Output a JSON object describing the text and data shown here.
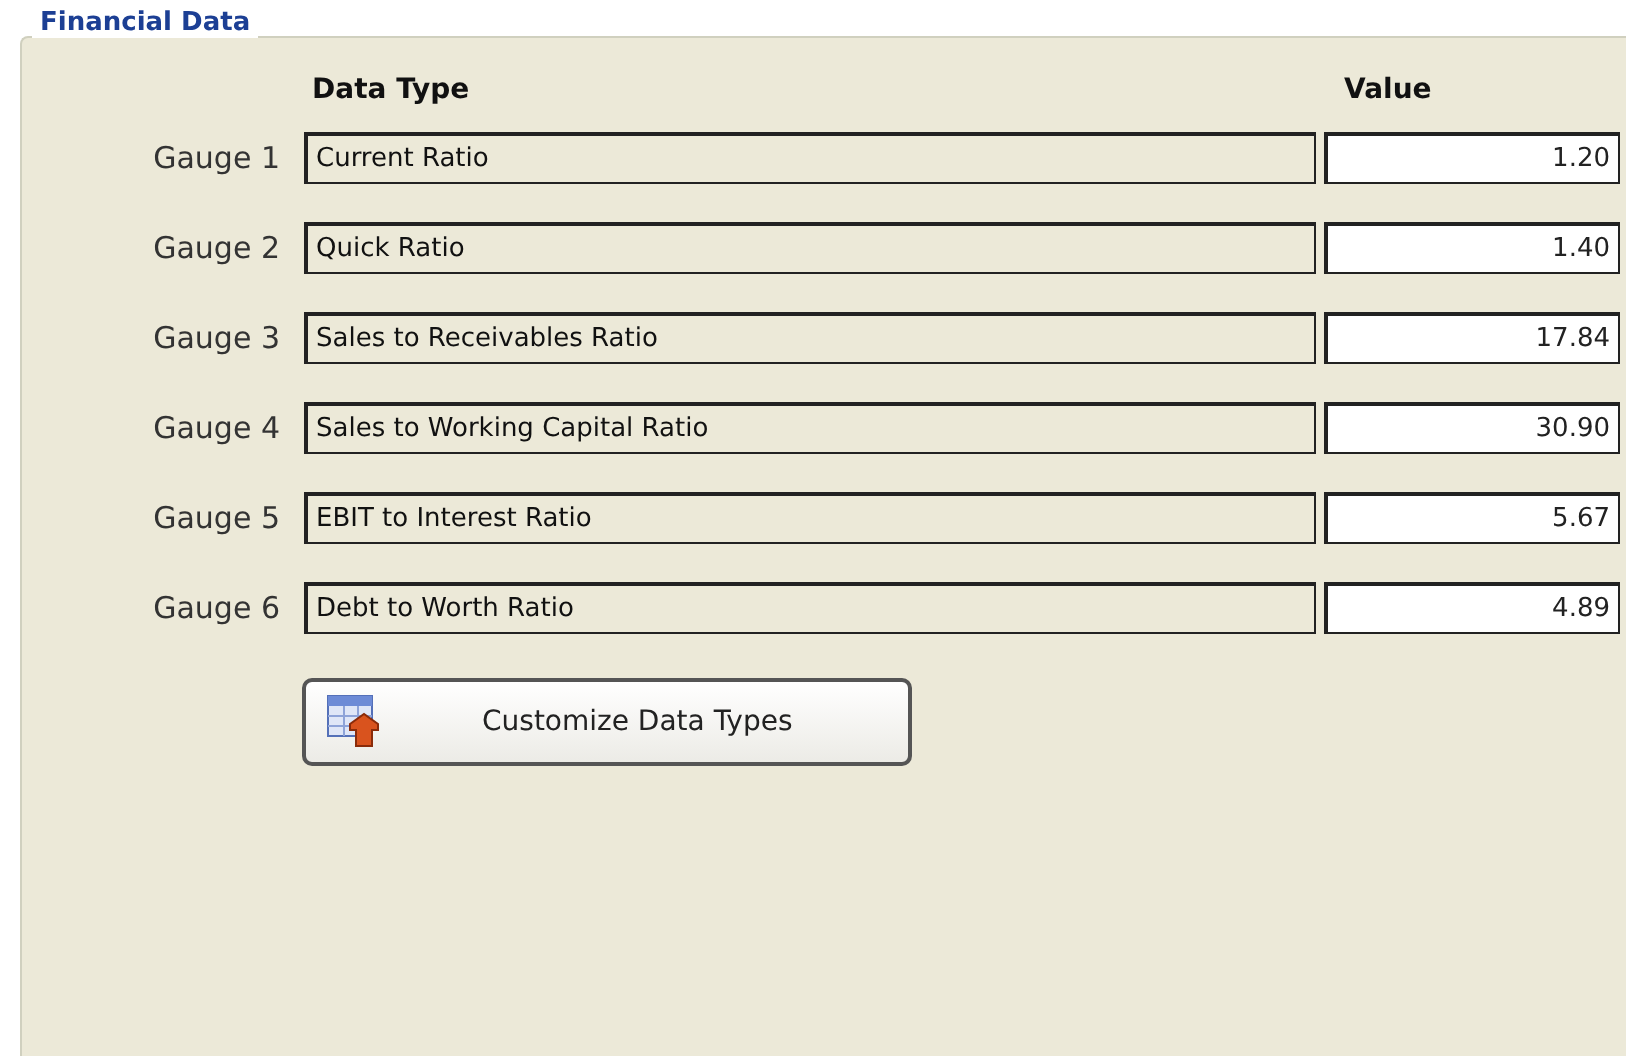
{
  "group": {
    "title": "Financial Data"
  },
  "columns": [
    "Data Type",
    "Value"
  ],
  "rows": [
    {
      "label": "Gauge 1",
      "data_type": "Current Ratio",
      "value": "1.20"
    },
    {
      "label": "Gauge 2",
      "data_type": "Quick Ratio",
      "value": "1.40"
    },
    {
      "label": "Gauge 3",
      "data_type": "Sales to Receivables Ratio",
      "value": "17.84"
    },
    {
      "label": "Gauge 4",
      "data_type": "Sales to Working Capital Ratio",
      "value": "30.90"
    },
    {
      "label": "Gauge 5",
      "data_type": "EBIT to Interest Ratio",
      "value": "5.67"
    },
    {
      "label": "Gauge 6",
      "data_type": "Debt to Worth Ratio",
      "value": "4.89"
    }
  ],
  "button": {
    "label": "Customize Data Types"
  }
}
